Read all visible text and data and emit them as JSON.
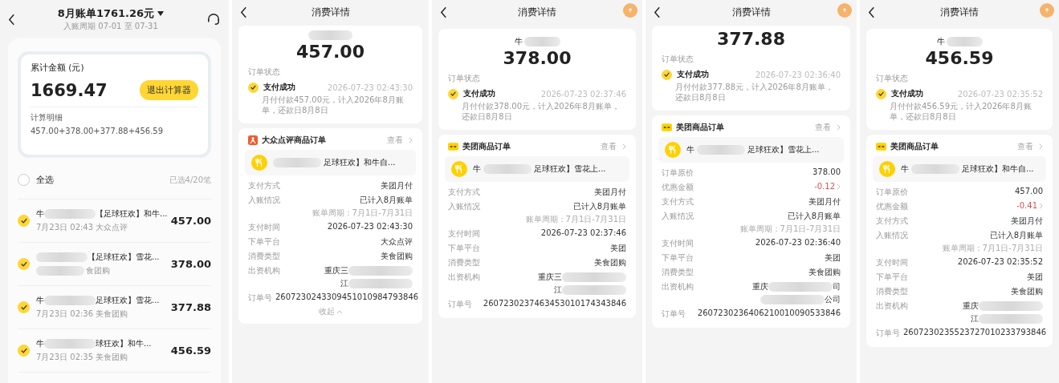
{
  "bill": {
    "title": "8月账单1761.26元",
    "period": "入账周期 07-01 至 07-31",
    "total_label": "累计金额 (元)",
    "total": "1669.47",
    "exit_button": "退出计算器",
    "detail_label": "计算明细",
    "formula": "457.00+378.00+377.88+456.59",
    "select_all": {
      "label": "全选",
      "checked": false
    },
    "selected_count": "已选4/20笔",
    "items": [
      {
        "name_start": "牛",
        "name_end": "【足球狂欢】和牛...",
        "sub_start": "7月23日  02:43  大众点评",
        "amount": "457.00",
        "checked": true
      },
      {
        "name_end": "【足球狂欢】雪花...",
        "sub_end": "食团购",
        "amount": "378.00",
        "checked": true
      },
      {
        "name_start": "牛",
        "name_end": "足球狂欢】雪花...",
        "sub_start": "7月23日  02:36  美食团购",
        "amount": "377.88",
        "checked": true
      },
      {
        "name_start": "牛",
        "name_end": "球狂欢】和牛...",
        "sub_start": "7月23日  02:35  美食团购",
        "amount": "456.59",
        "checked": true
      }
    ]
  },
  "details": [
    {
      "title": "消费详情",
      "amount": "457.00",
      "status_label": "订单状态",
      "status": "支付成功",
      "status_time": "2026-07-23 02:43:30",
      "status_note": "月付付款457.00元，计入2026年8月账单，还款日8月8日",
      "order": {
        "kind": "dianping",
        "source": "大众点评商品订单",
        "view": "查看",
        "item_end": "足球狂欢】和牛自..."
      },
      "fields": [
        {
          "kind": "plain",
          "label": "支付方式",
          "value": "美团月付"
        },
        {
          "kind": "account",
          "label": "入账情况",
          "value": "已计入8月账单",
          "sub": "账单周期：7月1日-7月31日"
        },
        {
          "kind": "plain",
          "label": "支付时间",
          "value": "2026-07-23  02:43:30"
        },
        {
          "kind": "plain",
          "label": "下单平台",
          "value": "大众点评"
        },
        {
          "kind": "plain",
          "label": "消费类型",
          "value": "美食团购"
        },
        {
          "kind": "lender",
          "label": "出资机构",
          "lines": [
            {
              "start": "重庆三"
            },
            {
              "start": "江"
            }
          ]
        },
        {
          "kind": "plain",
          "label": "订单号",
          "value": "2607230243309451010984793846"
        }
      ],
      "collapse": "收起"
    },
    {
      "title": "消费详情",
      "payee": "牛",
      "amount": "378.00",
      "status_label": "订单状态",
      "status": "支付成功",
      "status_time": "2026-07-23 02:37:46",
      "status_note": "月付付款378.00元，计入2026年8月账单，还款日8月8日",
      "order": {
        "kind": "meituan",
        "source": "美团商品订单",
        "view": "查看",
        "item_start": "牛",
        "item_end": "足球狂欢】雪花上..."
      },
      "fields": [
        {
          "kind": "plain",
          "label": "支付方式",
          "value": "美团月付"
        },
        {
          "kind": "account",
          "label": "入账情况",
          "value": "已计入8月账单",
          "sub": "账单周期：7月1日-7月31日"
        },
        {
          "kind": "plain",
          "label": "支付时间",
          "value": "2026-07-23  02:37:46"
        },
        {
          "kind": "plain",
          "label": "下单平台",
          "value": "美团"
        },
        {
          "kind": "plain",
          "label": "消费类型",
          "value": "美食团购"
        },
        {
          "kind": "lender",
          "label": "出资机构",
          "lines": [
            {
              "start": "重庆三"
            },
            {
              "start": "江"
            }
          ]
        },
        {
          "kind": "plain",
          "label": "订单号",
          "value": "2607230237463453010174343846"
        }
      ]
    },
    {
      "title": "消费详情",
      "amount": "377.88",
      "status_label": "订单状态",
      "status": "支付成功",
      "status_time": "2026-07-23 02:36:40",
      "status_note": "月付付款377.88元，计入2026年8月账单，还款日8月8日",
      "order": {
        "kind": "meituan",
        "source": "美团商品订单",
        "view": "查看",
        "item_start": "牛",
        "item_end": "足球狂欢】雪花上..."
      },
      "fields": [
        {
          "kind": "plain",
          "label": "订单原价",
          "value": "378.00"
        },
        {
          "kind": "discount",
          "label": "优惠金额",
          "value": "-0.12"
        },
        {
          "kind": "plain",
          "label": "支付方式",
          "value": "美团月付"
        },
        {
          "kind": "account",
          "label": "入账情况",
          "value": "已计入8月账单",
          "sub": "账单周期：7月1日-7月31日"
        },
        {
          "kind": "plain",
          "label": "支付时间",
          "value": "2026-07-23  02:36:40"
        },
        {
          "kind": "plain",
          "label": "下单平台",
          "value": "美团"
        },
        {
          "kind": "plain",
          "label": "消费类型",
          "value": "美食团购"
        },
        {
          "kind": "lender",
          "label": "出资机构",
          "lines": [
            {
              "start": "重庆",
              "end": "司"
            },
            {
              "end": "公司"
            }
          ]
        },
        {
          "kind": "plain",
          "label": "订单号",
          "value": "2607230236406210010090533846"
        }
      ]
    },
    {
      "title": "消费详情",
      "payee": "牛",
      "amount": "456.59",
      "status_label": "订单状态",
      "status": "支付成功",
      "status_time": "2026-07-23 02:35:52",
      "status_note": "月付付款456.59元，计入2026年8月账单，还款日8月8日",
      "order": {
        "kind": "meituan",
        "source": "美团商品订单",
        "view": "查看",
        "item_start": "牛",
        "item_end": "足球狂欢】和牛自..."
      },
      "fields": [
        {
          "kind": "plain",
          "label": "订单原价",
          "value": "457.00"
        },
        {
          "kind": "discount",
          "label": "优惠金额",
          "value": "-0.41"
        },
        {
          "kind": "plain",
          "label": "支付方式",
          "value": "美团月付"
        },
        {
          "kind": "account",
          "label": "入账情况",
          "value": "已计入8月账单",
          "sub": "账单周期：7月1日-7月31日"
        },
        {
          "kind": "plain",
          "label": "支付时间",
          "value": "2026-07-23  02:35:52"
        },
        {
          "kind": "plain",
          "label": "下单平台",
          "value": "美团"
        },
        {
          "kind": "plain",
          "label": "消费类型",
          "value": "美食团购"
        },
        {
          "kind": "lender",
          "label": "出资机构",
          "lines": [
            {
              "start": "重庆"
            },
            {
              "start": "江"
            }
          ]
        },
        {
          "kind": "plain",
          "label": "订单号",
          "value": "2607230235523727010233793846"
        }
      ]
    }
  ]
}
